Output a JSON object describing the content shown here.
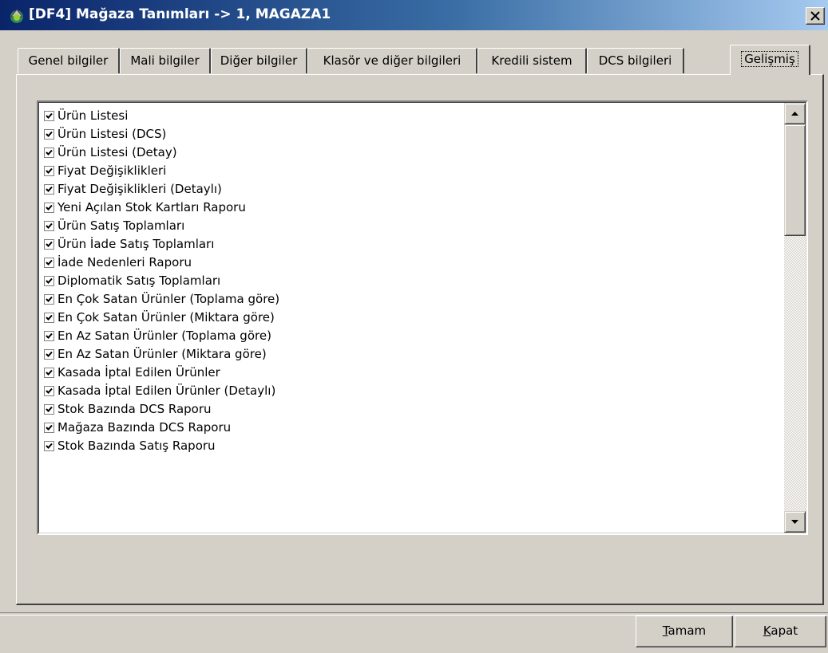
{
  "window": {
    "title": "[DF4] Mağaza Tanımları -> 1, MAGAZA1",
    "icon": "store-app-icon",
    "close_icon": "close-icon"
  },
  "tabs": [
    {
      "label": "Genel bilgiler"
    },
    {
      "label": "Mali bilgiler"
    },
    {
      "label": "Diğer bilgiler"
    },
    {
      "label": "Klasör ve diğer bilgileri"
    },
    {
      "label": "Kredili sistem"
    },
    {
      "label": "DCS bilgileri"
    },
    {
      "label": "Gelişmiş",
      "active": true
    }
  ],
  "report_list": {
    "items": [
      {
        "label": "Ürün Listesi",
        "checked": true
      },
      {
        "label": "Ürün Listesi (DCS)",
        "checked": true
      },
      {
        "label": "Ürün Listesi (Detay)",
        "checked": true
      },
      {
        "label": "Fiyat Değişiklikleri",
        "checked": true
      },
      {
        "label": "Fiyat Değişiklikleri (Detaylı)",
        "checked": true
      },
      {
        "label": "Yeni Açılan Stok Kartları Raporu",
        "checked": true
      },
      {
        "label": "Ürün Satış Toplamları",
        "checked": true
      },
      {
        "label": "Ürün İade Satış Toplamları",
        "checked": true
      },
      {
        "label": "İade Nedenleri Raporu",
        "checked": true
      },
      {
        "label": "Diplomatik Satış Toplamları",
        "checked": true
      },
      {
        "label": "En Çok Satan Ürünler (Toplama göre)",
        "checked": true
      },
      {
        "label": "En Çok Satan Ürünler (Miktara göre)",
        "checked": true
      },
      {
        "label": "En Az Satan Ürünler (Toplama göre)",
        "checked": true
      },
      {
        "label": "En Az Satan Ürünler (Miktara göre)",
        "checked": true
      },
      {
        "label": "Kasada İptal Edilen Ürünler",
        "checked": true
      },
      {
        "label": "Kasada İptal Edilen Ürünler (Detaylı)",
        "checked": true
      },
      {
        "label": "Stok Bazında DCS Raporu",
        "checked": true
      },
      {
        "label": "Mağaza Bazında DCS Raporu",
        "checked": true
      },
      {
        "label": "Stok Bazında Satış Raporu",
        "checked": true
      }
    ]
  },
  "buttons": {
    "ok": {
      "mnemonic": "T",
      "rest": "amam"
    },
    "close": {
      "mnemonic": "K",
      "rest": "apat"
    }
  }
}
